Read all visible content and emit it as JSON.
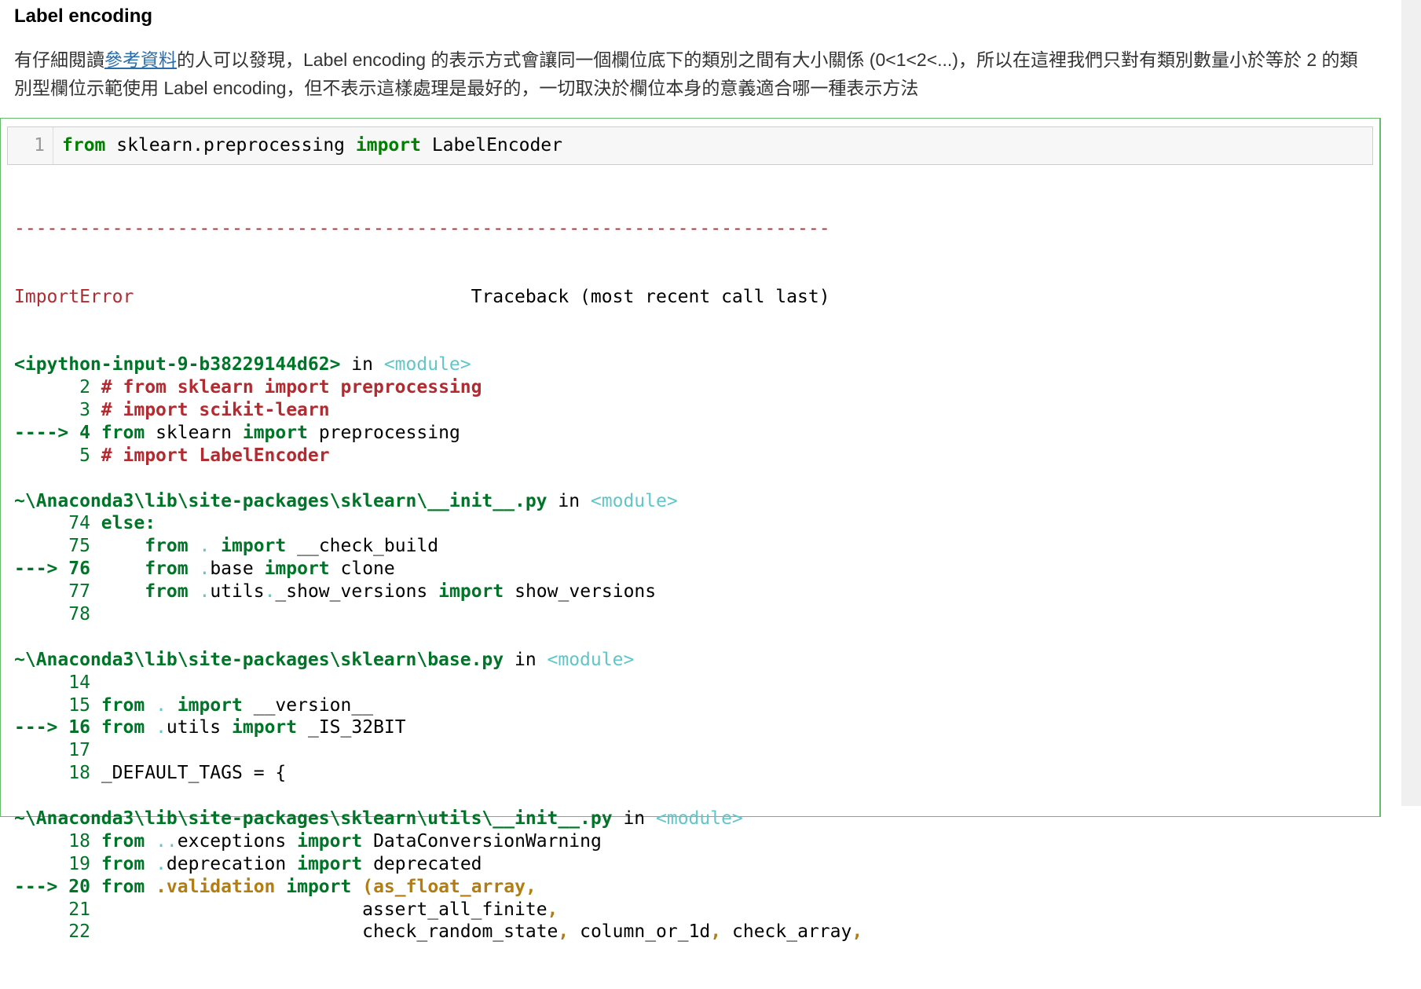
{
  "markdown": {
    "heading": "Label encoding",
    "para_before_link": "有仔細閱讀",
    "link_text": "參考資料",
    "para_after_link": "的人可以發現，Label encoding 的表示方式會讓同一個欄位底下的類別之間有大小關係 (0<1<2<...)，所以在這裡我們只對有類別數量小於等於 2 的類別型欄位示範使用 Label encoding，但不表示這樣處理是最好的，一切取決於欄位本身的意義適合哪一種表示方法"
  },
  "input": {
    "line_number": "1",
    "kw_from": "from",
    "module": " sklearn.preprocessing ",
    "kw_import": "import",
    "name": " LabelEncoder"
  },
  "traceback": {
    "separator": "---------------------------------------------------------------------------",
    "error_name": "ImportError",
    "header_tail": "                               Traceback (most recent call last)",
    "frames": [
      {
        "file": "<ipython-input-9-b38229144d62>",
        "in": " in ",
        "scope": "<module>",
        "lines": [
          {
            "arrow": "      ",
            "num": "2",
            "text": " # from sklearn import preprocessing",
            "style": "comment"
          },
          {
            "arrow": "      ",
            "num": "3",
            "text": " # import scikit-learn",
            "style": "comment"
          },
          {
            "arrow": "----> ",
            "num": "4",
            "text": " from sklearn import preprocessing",
            "style": "current"
          },
          {
            "arrow": "      ",
            "num": "5",
            "text": " # import LabelEncoder",
            "style": "comment"
          }
        ]
      },
      {
        "file": "~\\Anaconda3\\lib\\site-packages\\sklearn\\__init__.py",
        "in": " in ",
        "scope": "<module>",
        "lines": [
          {
            "arrow": "     ",
            "num": "74",
            "text": " else:",
            "style": "else"
          },
          {
            "arrow": "     ",
            "num": "75",
            "text": "     from . import __check_build",
            "style": "code"
          },
          {
            "arrow": "---> ",
            "num": "76",
            "text": "     from .base import clone",
            "style": "current"
          },
          {
            "arrow": "     ",
            "num": "77",
            "text": "     from .utils._show_versions import show_versions",
            "style": "code"
          },
          {
            "arrow": "     ",
            "num": "78",
            "text": "",
            "style": "code"
          }
        ]
      },
      {
        "file": "~\\Anaconda3\\lib\\site-packages\\sklearn\\base.py",
        "in": " in ",
        "scope": "<module>",
        "lines": [
          {
            "arrow": "     ",
            "num": "14",
            "text": "",
            "style": "code"
          },
          {
            "arrow": "     ",
            "num": "15",
            "text": " from . import __version__",
            "style": "code"
          },
          {
            "arrow": "---> ",
            "num": "16",
            "text": " from .utils import _IS_32BIT",
            "style": "current"
          },
          {
            "arrow": "     ",
            "num": "17",
            "text": "",
            "style": "code"
          },
          {
            "arrow": "     ",
            "num": "18",
            "text": " _DEFAULT_TAGS = {",
            "style": "code"
          }
        ]
      },
      {
        "file": "~\\Anaconda3\\lib\\site-packages\\sklearn\\utils\\__init__.py",
        "in": " in ",
        "scope": "<module>",
        "lines": [
          {
            "arrow": "     ",
            "num": "18",
            "text": " from ..exceptions import DataConversionWarning",
            "style": "code"
          },
          {
            "arrow": "     ",
            "num": "19",
            "text": " from .deprecation import deprecated",
            "style": "code"
          },
          {
            "arrow": "---> ",
            "num": "20",
            "text": " from .validation import (as_float_array,",
            "style": "current-yellow"
          },
          {
            "arrow": "     ",
            "num": "21",
            "text": "                         assert_all_finite,",
            "style": "code-yellow-tail"
          },
          {
            "arrow": "     ",
            "num": "22",
            "text": "                         check_random_state, column_or_1d, check_array,",
            "style": "code-yellow-tail"
          }
        ]
      }
    ]
  }
}
